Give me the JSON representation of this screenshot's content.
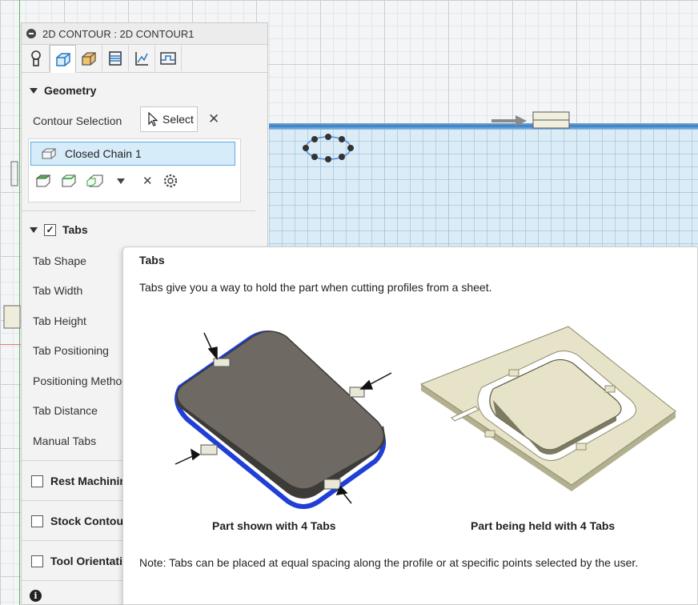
{
  "panel": {
    "title": "2D CONTOUR : 2D CONTOUR1",
    "tabs": [
      "tool-icon",
      "geometry-icon",
      "heights-icon",
      "passes-icon",
      "linking-icon",
      "shop-floor-icon"
    ],
    "geometry": {
      "header": "Geometry",
      "contour_selection_label": "Contour Selection",
      "select_label": "Select",
      "chain_item": "Closed Chain 1"
    },
    "tabs_section": {
      "header": "Tabs",
      "checked": true,
      "params": [
        "Tab Shape",
        "Tab Width",
        "Tab Height",
        "Tab Positioning",
        "Positioning Method",
        "Tab Distance",
        "Manual Tabs"
      ]
    },
    "collapsed_sections": [
      {
        "label": "Rest Machining",
        "checked": false
      },
      {
        "label": "Stock Contours",
        "checked": false
      },
      {
        "label": "Tool Orientation",
        "checked": false
      }
    ]
  },
  "tooltip": {
    "title": "Tabs",
    "description": "Tabs give you a way to hold the part when cutting profiles from a sheet.",
    "caption_left": "Part shown with 4 Tabs",
    "caption_right": "Part being held with 4 Tabs",
    "note": "Note: Tabs can be placed at equal spacing along the profile or at specific points selected by the user."
  },
  "colors": {
    "selection_fill": "#d6ecf9",
    "selection_border": "#5aaee2",
    "stock_blue": "#3b7fc3",
    "part_dark": "#6e6a63",
    "sheet_tan": "#e6e3c8"
  }
}
